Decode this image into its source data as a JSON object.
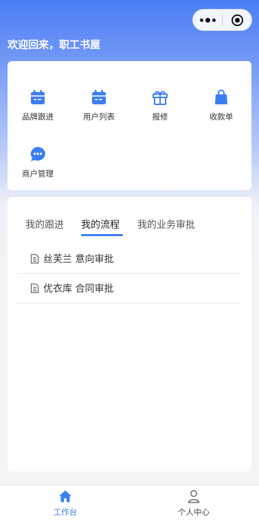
{
  "header": {
    "welcome": "欢迎回来，职工书屋"
  },
  "menu": {
    "items": [
      {
        "label": "品牌跟进",
        "icon": "calendar-icon"
      },
      {
        "label": "用户列表",
        "icon": "calendar-icon"
      },
      {
        "label": "报修",
        "icon": "gift-icon"
      },
      {
        "label": "收款单",
        "icon": "shopping-bag-icon"
      },
      {
        "label": "商户管理",
        "icon": "chat-bubble-icon"
      }
    ]
  },
  "tabs": {
    "items": [
      {
        "label": "我的跟进"
      },
      {
        "label": "我的流程"
      },
      {
        "label": "我的业务审批"
      }
    ],
    "active": "我的流程"
  },
  "flows": [
    {
      "label": "丝芙兰 意向审批",
      "icon": "document-icon"
    },
    {
      "label": "优衣库 合同审批",
      "icon": "document-icon"
    }
  ],
  "tabbar": {
    "items": [
      {
        "label": "工作台",
        "icon": "home-icon"
      },
      {
        "label": "个人中心",
        "icon": "user-icon"
      }
    ],
    "active": "工作台"
  },
  "colors": {
    "accent": "#3c7ef2",
    "header_gradient_top": "#4a7df5"
  }
}
